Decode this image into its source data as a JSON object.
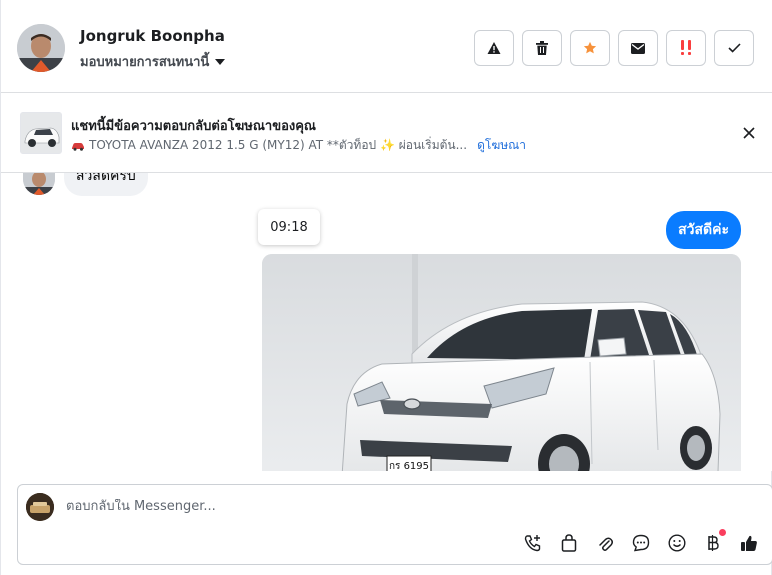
{
  "header": {
    "contact_name": "Jongruk Boonpha",
    "assign_label": "มอบหมายการสนทนานี้",
    "actions": [
      {
        "name": "report-button",
        "icon": "warning-icon"
      },
      {
        "name": "delete-button",
        "icon": "trash-icon"
      },
      {
        "name": "star-button",
        "icon": "star-icon"
      },
      {
        "name": "mark-unread-button",
        "icon": "envelope-icon"
      },
      {
        "name": "priority-button",
        "icon": "double-exclamation-icon"
      },
      {
        "name": "done-button",
        "icon": "checkmark-icon"
      }
    ]
  },
  "ad_banner": {
    "title": "แชทนี้มีข้อความตอบกลับต่อโฆษณาของคุณ",
    "description": "TOYOTA AVANZA 2012 1.5 G (MY12) AT **ตัวท็อป ✨ ผ่อนเริ่มต้น...",
    "link_label": "ดูโฆษณา"
  },
  "messages": {
    "incoming_text": "สวัสดีครับ",
    "outgoing_text": "สวัสดีค่ะ",
    "timestamp": "09:18",
    "photo_plate": "กร 6195"
  },
  "composer": {
    "placeholder": "ตอบกลับใน Messenger..."
  },
  "colors": {
    "accent": "#0a7cff",
    "star": "#f7923b",
    "priority": "#fa3e3e",
    "link": "#216fdb",
    "notification_dot": "#fa3e5e"
  }
}
